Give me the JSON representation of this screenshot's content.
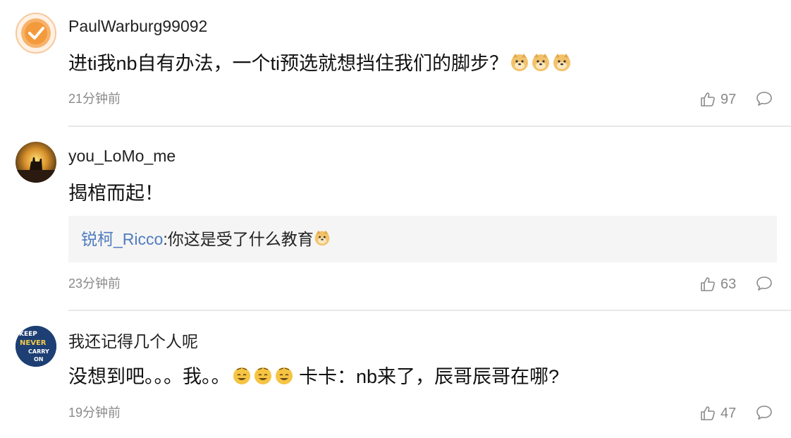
{
  "comments": [
    {
      "username": "PaulWarburg99092",
      "text": "进ti我nb自有办法，一个ti预选就想挡住我们的脚步？",
      "emojis": [
        "doge-emoji",
        "doge-emoji",
        "doge-emoji"
      ],
      "time": "21分钟前",
      "likes": "97"
    },
    {
      "username": "you_LoMo_me",
      "text": "揭棺而起！",
      "reply": {
        "user": "锐柯_Ricco",
        "separator": ":",
        "text": "你这是受了什么教育",
        "emojis": [
          "doge-emoji"
        ]
      },
      "time": "23分钟前",
      "likes": "63"
    },
    {
      "username": "我还记得几个人呢",
      "text_before": "没想到吧。。。我。。",
      "emojis": [
        "sweat-smile-emoji",
        "sweat-smile-emoji",
        "sweat-smile-emoji"
      ],
      "text_after": " 卡卡：nb来了，辰哥辰哥在哪?",
      "time": "19分钟前",
      "likes": "47"
    }
  ],
  "avatars": {
    "first": "checkmark-badge-avatar",
    "second": "sunset-silhouette-avatar",
    "third": "keep-calm-poster-avatar",
    "third_text": [
      "KEEP",
      "NEVER",
      "CARRY",
      "ON"
    ]
  },
  "colors": {
    "reply_user": "#4f7cbf",
    "badge_orange": "#f39a3c",
    "divider": "#e8e8e8",
    "meta_gray": "#8a8a8a"
  }
}
